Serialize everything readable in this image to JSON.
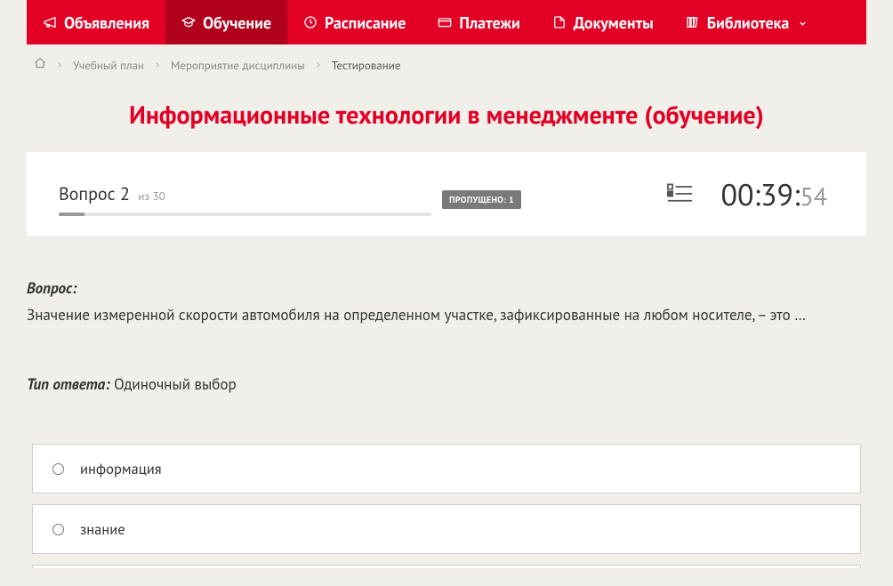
{
  "nav": {
    "items": [
      {
        "label": "Объявления",
        "icon": "megaphone-icon",
        "active": false
      },
      {
        "label": "Обучение",
        "icon": "graduation-icon",
        "active": true
      },
      {
        "label": "Расписание",
        "icon": "clock-icon",
        "active": false
      },
      {
        "label": "Платежи",
        "icon": "card-icon",
        "active": false
      },
      {
        "label": "Документы",
        "icon": "document-icon",
        "active": false
      },
      {
        "label": "Библиотека",
        "icon": "library-icon",
        "active": false,
        "dropdown": true
      }
    ]
  },
  "breadcrumb": {
    "items": [
      "Учебный план",
      "Мероприятие дисциплины"
    ],
    "current": "Тестирование"
  },
  "page_title": "Информационные технологии в менеджменте (обучение)",
  "question_status": {
    "question_label": "Вопрос",
    "current": "2",
    "of_label": "из",
    "total": "30",
    "skipped_label": "ПРОПУЩЕНО:",
    "skipped_count": "1",
    "timer_min": "00:39:",
    "timer_sec": "54"
  },
  "question": {
    "label": "Вопрос:",
    "text": "Значение измеренной скорости автомобиля на определенном участке, зафиксированные на любом носителе, – это …",
    "type_label": "Тип ответа:",
    "type_value": "Одиночный выбор"
  },
  "answers": [
    {
      "label": "информация"
    },
    {
      "label": "знание"
    }
  ]
}
